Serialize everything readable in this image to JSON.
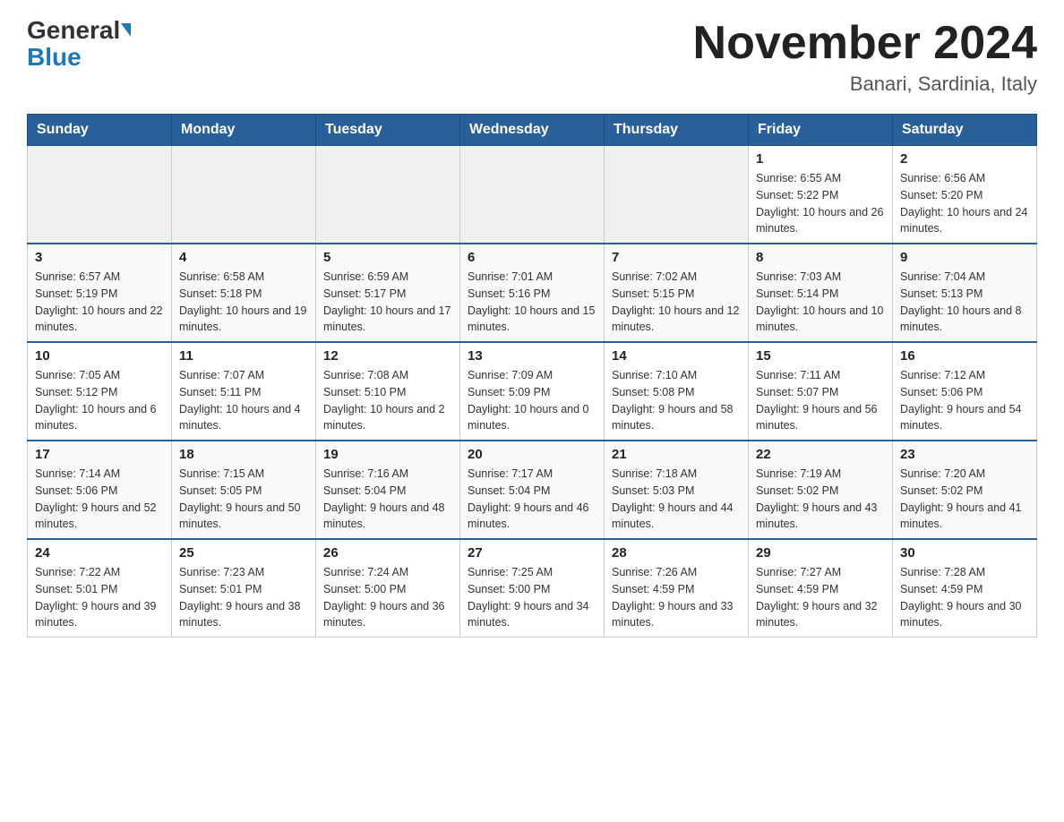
{
  "header": {
    "logo_general": "General",
    "logo_blue": "Blue",
    "month_title": "November 2024",
    "location": "Banari, Sardinia, Italy"
  },
  "weekdays": [
    "Sunday",
    "Monday",
    "Tuesday",
    "Wednesday",
    "Thursday",
    "Friday",
    "Saturday"
  ],
  "weeks": [
    [
      {
        "day": "",
        "info": ""
      },
      {
        "day": "",
        "info": ""
      },
      {
        "day": "",
        "info": ""
      },
      {
        "day": "",
        "info": ""
      },
      {
        "day": "",
        "info": ""
      },
      {
        "day": "1",
        "info": "Sunrise: 6:55 AM\nSunset: 5:22 PM\nDaylight: 10 hours and 26 minutes."
      },
      {
        "day": "2",
        "info": "Sunrise: 6:56 AM\nSunset: 5:20 PM\nDaylight: 10 hours and 24 minutes."
      }
    ],
    [
      {
        "day": "3",
        "info": "Sunrise: 6:57 AM\nSunset: 5:19 PM\nDaylight: 10 hours and 22 minutes."
      },
      {
        "day": "4",
        "info": "Sunrise: 6:58 AM\nSunset: 5:18 PM\nDaylight: 10 hours and 19 minutes."
      },
      {
        "day": "5",
        "info": "Sunrise: 6:59 AM\nSunset: 5:17 PM\nDaylight: 10 hours and 17 minutes."
      },
      {
        "day": "6",
        "info": "Sunrise: 7:01 AM\nSunset: 5:16 PM\nDaylight: 10 hours and 15 minutes."
      },
      {
        "day": "7",
        "info": "Sunrise: 7:02 AM\nSunset: 5:15 PM\nDaylight: 10 hours and 12 minutes."
      },
      {
        "day": "8",
        "info": "Sunrise: 7:03 AM\nSunset: 5:14 PM\nDaylight: 10 hours and 10 minutes."
      },
      {
        "day": "9",
        "info": "Sunrise: 7:04 AM\nSunset: 5:13 PM\nDaylight: 10 hours and 8 minutes."
      }
    ],
    [
      {
        "day": "10",
        "info": "Sunrise: 7:05 AM\nSunset: 5:12 PM\nDaylight: 10 hours and 6 minutes."
      },
      {
        "day": "11",
        "info": "Sunrise: 7:07 AM\nSunset: 5:11 PM\nDaylight: 10 hours and 4 minutes."
      },
      {
        "day": "12",
        "info": "Sunrise: 7:08 AM\nSunset: 5:10 PM\nDaylight: 10 hours and 2 minutes."
      },
      {
        "day": "13",
        "info": "Sunrise: 7:09 AM\nSunset: 5:09 PM\nDaylight: 10 hours and 0 minutes."
      },
      {
        "day": "14",
        "info": "Sunrise: 7:10 AM\nSunset: 5:08 PM\nDaylight: 9 hours and 58 minutes."
      },
      {
        "day": "15",
        "info": "Sunrise: 7:11 AM\nSunset: 5:07 PM\nDaylight: 9 hours and 56 minutes."
      },
      {
        "day": "16",
        "info": "Sunrise: 7:12 AM\nSunset: 5:06 PM\nDaylight: 9 hours and 54 minutes."
      }
    ],
    [
      {
        "day": "17",
        "info": "Sunrise: 7:14 AM\nSunset: 5:06 PM\nDaylight: 9 hours and 52 minutes."
      },
      {
        "day": "18",
        "info": "Sunrise: 7:15 AM\nSunset: 5:05 PM\nDaylight: 9 hours and 50 minutes."
      },
      {
        "day": "19",
        "info": "Sunrise: 7:16 AM\nSunset: 5:04 PM\nDaylight: 9 hours and 48 minutes."
      },
      {
        "day": "20",
        "info": "Sunrise: 7:17 AM\nSunset: 5:04 PM\nDaylight: 9 hours and 46 minutes."
      },
      {
        "day": "21",
        "info": "Sunrise: 7:18 AM\nSunset: 5:03 PM\nDaylight: 9 hours and 44 minutes."
      },
      {
        "day": "22",
        "info": "Sunrise: 7:19 AM\nSunset: 5:02 PM\nDaylight: 9 hours and 43 minutes."
      },
      {
        "day": "23",
        "info": "Sunrise: 7:20 AM\nSunset: 5:02 PM\nDaylight: 9 hours and 41 minutes."
      }
    ],
    [
      {
        "day": "24",
        "info": "Sunrise: 7:22 AM\nSunset: 5:01 PM\nDaylight: 9 hours and 39 minutes."
      },
      {
        "day": "25",
        "info": "Sunrise: 7:23 AM\nSunset: 5:01 PM\nDaylight: 9 hours and 38 minutes."
      },
      {
        "day": "26",
        "info": "Sunrise: 7:24 AM\nSunset: 5:00 PM\nDaylight: 9 hours and 36 minutes."
      },
      {
        "day": "27",
        "info": "Sunrise: 7:25 AM\nSunset: 5:00 PM\nDaylight: 9 hours and 34 minutes."
      },
      {
        "day": "28",
        "info": "Sunrise: 7:26 AM\nSunset: 4:59 PM\nDaylight: 9 hours and 33 minutes."
      },
      {
        "day": "29",
        "info": "Sunrise: 7:27 AM\nSunset: 4:59 PM\nDaylight: 9 hours and 32 minutes."
      },
      {
        "day": "30",
        "info": "Sunrise: 7:28 AM\nSunset: 4:59 PM\nDaylight: 9 hours and 30 minutes."
      }
    ]
  ]
}
